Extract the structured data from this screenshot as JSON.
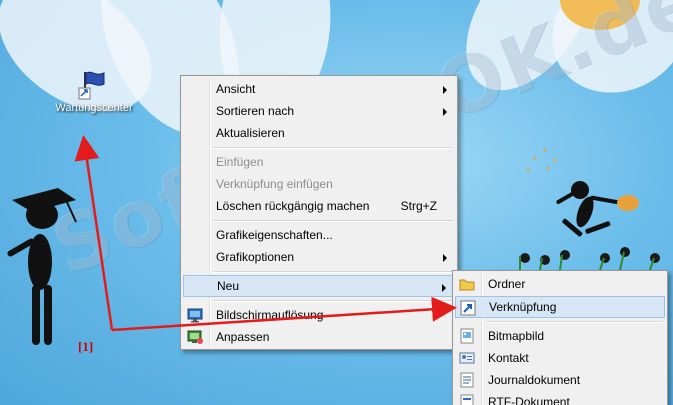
{
  "desktop": {
    "watermark": "SoftwareOK.de",
    "icon_label": "Wartungscenter",
    "annotation": "[1]",
    "colors": {
      "sky": "#6bbdea",
      "arrow": "#e31b1b",
      "menu_bg": "#f0f0f0",
      "highlight": "#d6e6f5"
    }
  },
  "context_menu": {
    "items": [
      {
        "label": "Ansicht",
        "submenu": true
      },
      {
        "label": "Sortieren nach",
        "submenu": true
      },
      {
        "label": "Aktualisieren"
      },
      {
        "label": "Einfügen",
        "disabled": true
      },
      {
        "label": "Verknüpfung einfügen",
        "disabled": true
      },
      {
        "label": "Löschen rückgängig machen",
        "shortcut": "Strg+Z"
      },
      {
        "label": "Grafikeigenschaften..."
      },
      {
        "label": "Grafikoptionen",
        "submenu": true
      },
      {
        "label": "Neu",
        "submenu": true,
        "highlighted": true
      },
      {
        "label": "Bildschirmauflösung",
        "icon": "display-icon"
      },
      {
        "label": "Anpassen",
        "icon": "personalize-icon"
      }
    ]
  },
  "submenu_new": {
    "items": [
      {
        "label": "Ordner",
        "icon": "folder-icon"
      },
      {
        "label": "Verknüpfung",
        "icon": "shortcut-icon",
        "highlighted": true
      },
      {
        "label": "Bitmapbild",
        "icon": "bitmap-icon"
      },
      {
        "label": "Kontakt",
        "icon": "contact-icon"
      },
      {
        "label": "Journaldokument",
        "icon": "journal-icon"
      },
      {
        "label": "RTF-Dokument",
        "icon": "rtf-icon"
      }
    ]
  }
}
